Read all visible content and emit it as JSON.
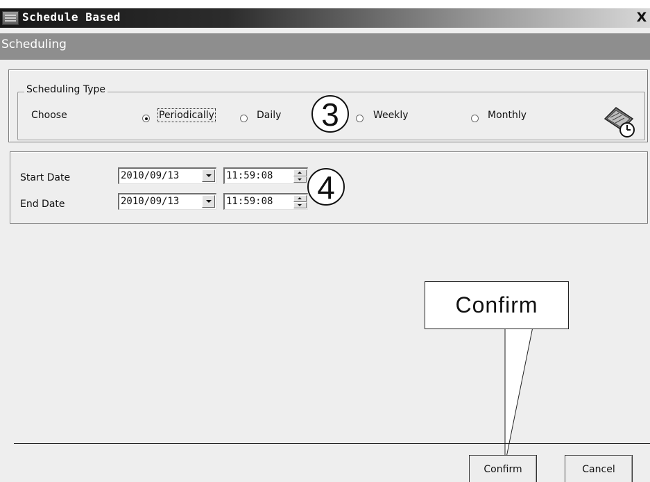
{
  "window": {
    "title": "Schedule Based",
    "close_label": "X"
  },
  "header": {
    "title": "Scheduling"
  },
  "scheduling_type": {
    "group_label": "Scheduling Type",
    "choose_label": "Choose",
    "options": [
      {
        "label": "Periodically",
        "selected": true
      },
      {
        "label": "Daily",
        "selected": false
      },
      {
        "label": "Weekly",
        "selected": false
      },
      {
        "label": "Monthly",
        "selected": false
      }
    ],
    "icon": "calendar-clock-icon"
  },
  "dates": {
    "start": {
      "label": "Start Date",
      "date": "2010/09/13",
      "time": "11:59:08"
    },
    "end": {
      "label": "End Date",
      "date": "2010/09/13",
      "time": "11:59:08"
    }
  },
  "annotations": {
    "step3": "3",
    "step4": "4",
    "callout": "Confirm"
  },
  "footer": {
    "confirm_label": "Confirm",
    "cancel_label": "Cancel"
  }
}
